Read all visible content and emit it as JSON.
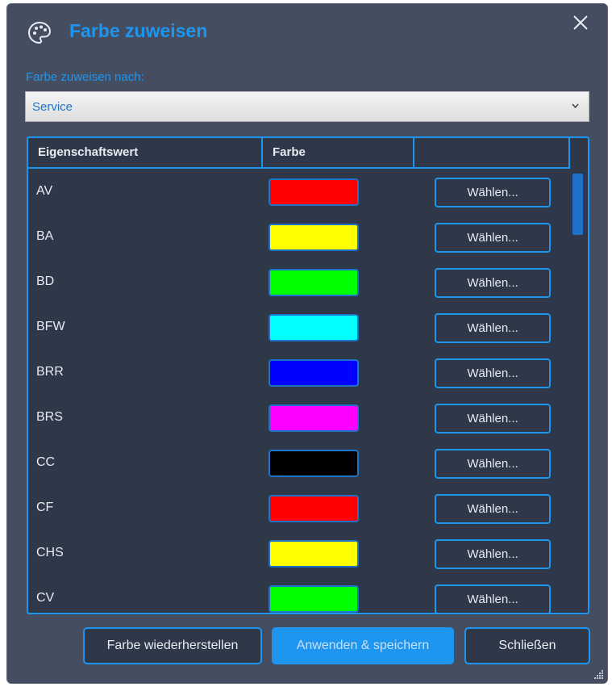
{
  "dialog": {
    "title": "Farbe zuweisen",
    "title_icon": "palette-icon",
    "close_icon": "close-icon"
  },
  "assign": {
    "label": "Farbe zuweisen nach:",
    "selected": "Service"
  },
  "table": {
    "headers": [
      "Eigenschaftswert",
      "Farbe",
      ""
    ],
    "rows": [
      {
        "name": "AV",
        "color": "#ff0000",
        "button": "Wählen..."
      },
      {
        "name": "BA",
        "color": "#ffff00",
        "button": "Wählen..."
      },
      {
        "name": "BD",
        "color": "#00ff00",
        "button": "Wählen..."
      },
      {
        "name": "BFW",
        "color": "#00ffff",
        "button": "Wählen..."
      },
      {
        "name": "BRR",
        "color": "#0000ff",
        "button": "Wählen..."
      },
      {
        "name": "BRS",
        "color": "#ff00ff",
        "button": "Wählen..."
      },
      {
        "name": "CC",
        "color": "#000000",
        "button": "Wählen..."
      },
      {
        "name": "CF",
        "color": "#ff0000",
        "button": "Wählen..."
      },
      {
        "name": "CHS",
        "color": "#ffff00",
        "button": "Wählen..."
      },
      {
        "name": "CV",
        "color": "#00ff00",
        "button": "Wählen..."
      }
    ]
  },
  "buttons": {
    "restore": "Farbe wiederherstellen",
    "apply": "Anwenden & speichern",
    "close": "Schließen"
  },
  "colors": {
    "accent": "#1e96f0",
    "background": "#454e60",
    "table_background": "#2e3848"
  }
}
